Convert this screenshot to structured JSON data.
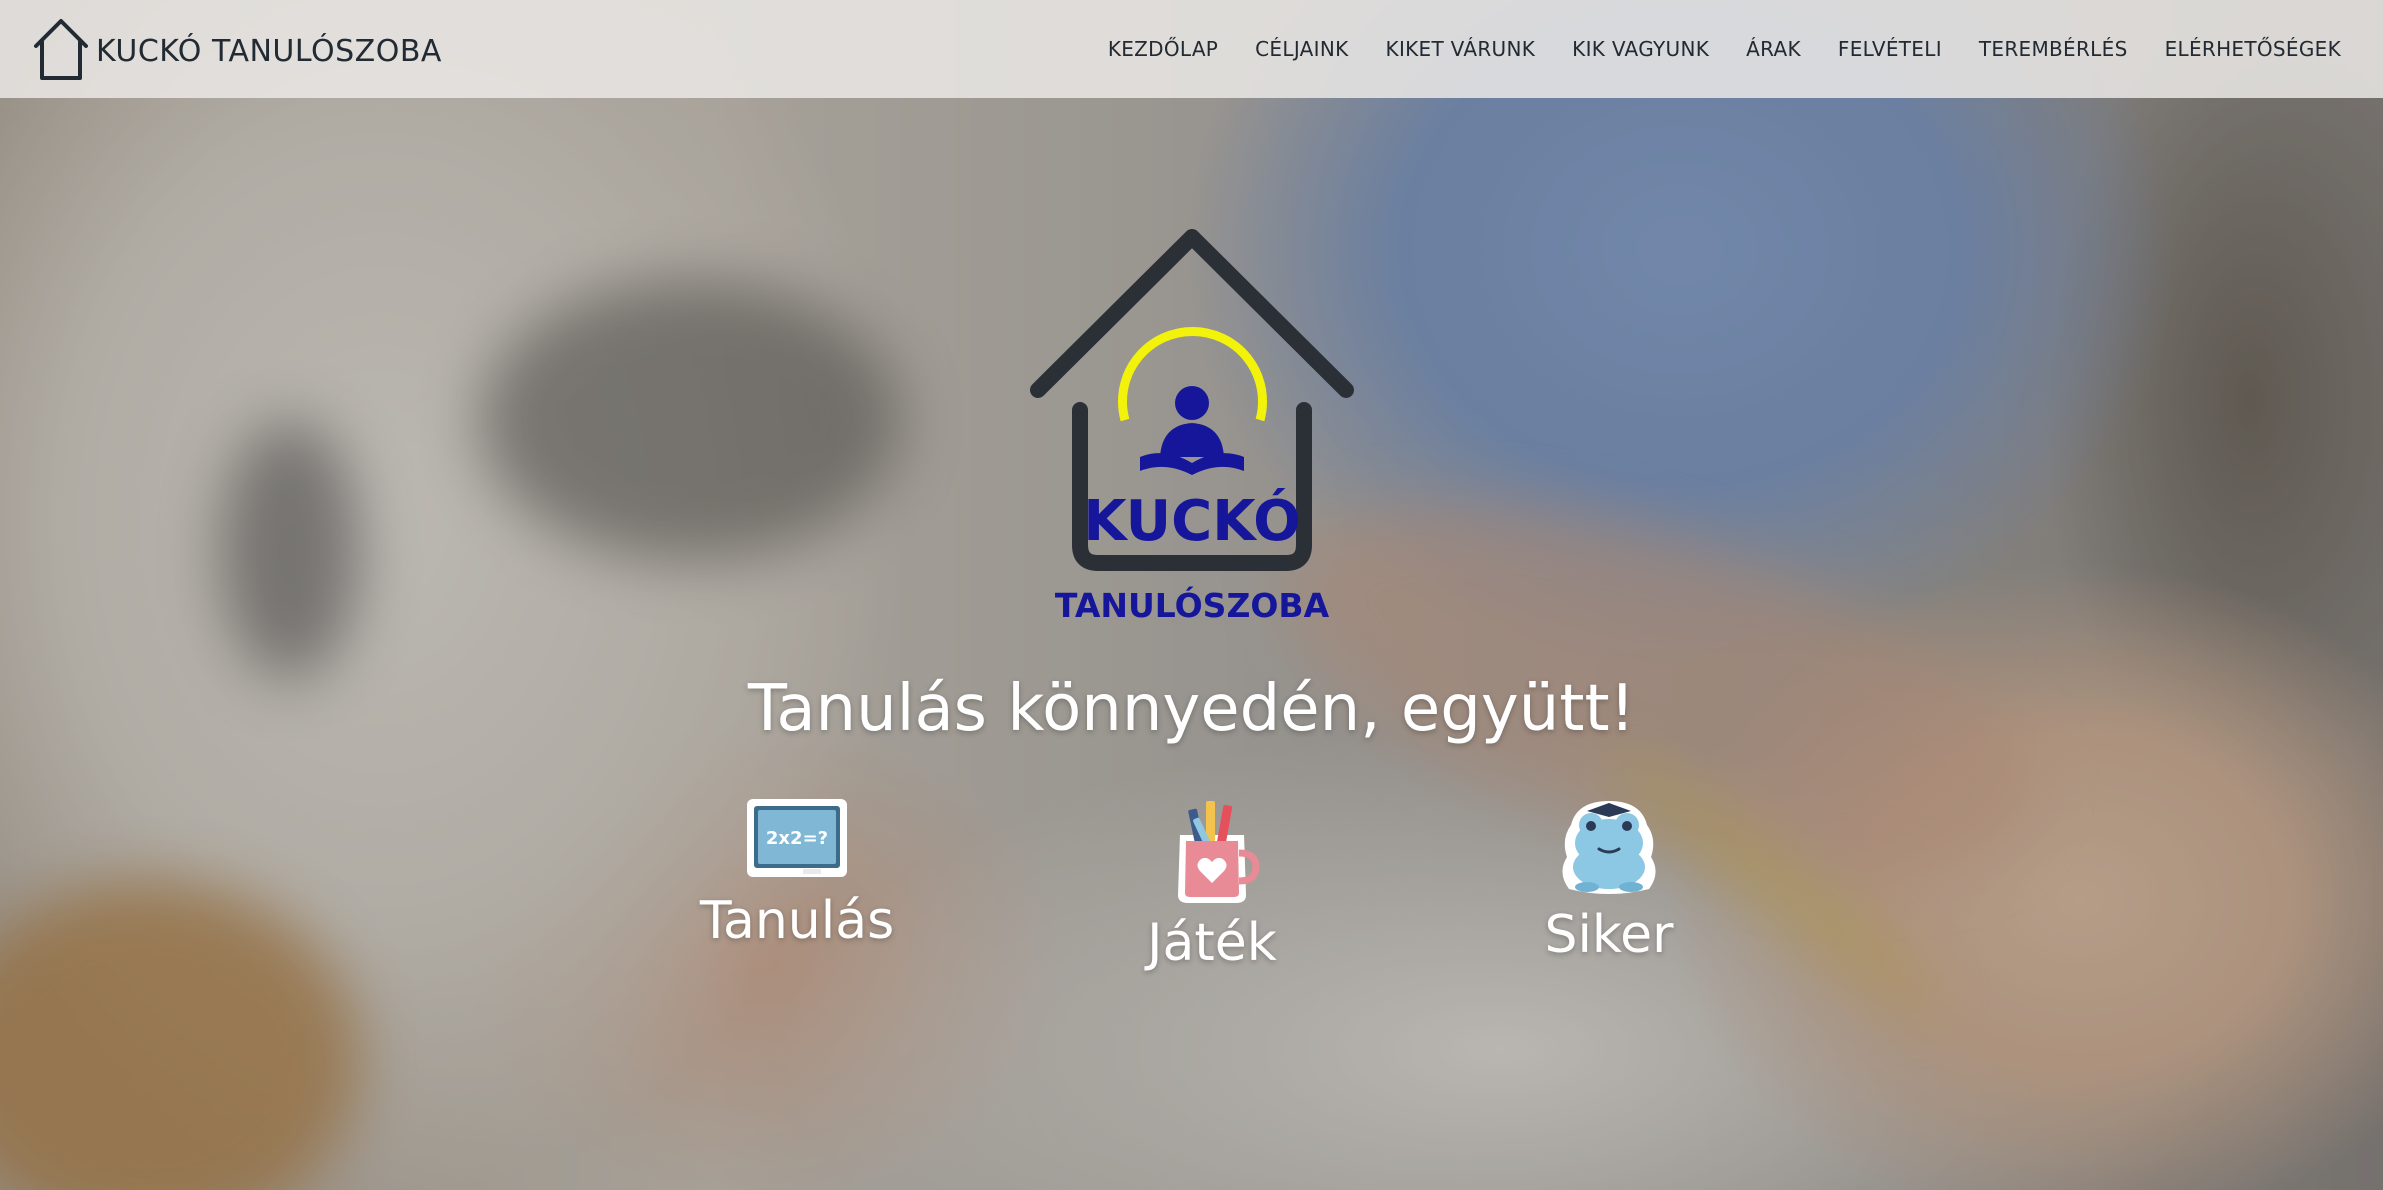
{
  "nav": {
    "brand": "KUCKÓ TANULÓSZOBA",
    "items": [
      {
        "label": "KEZDŐLAP"
      },
      {
        "label": "CÉLJAINK"
      },
      {
        "label": "KIKET VÁRUNK"
      },
      {
        "label": "KIK VAGYUNK"
      },
      {
        "label": "ÁRAK"
      },
      {
        "label": "FELVÉTELI"
      },
      {
        "label": "TEREMBÉRLÉS"
      },
      {
        "label": "ELÉRHETŐSÉGEK"
      }
    ]
  },
  "hero": {
    "logo": {
      "title": "KUCKÓ",
      "subtitle": "TANULÓSZOBA"
    },
    "tagline": "Tanulás könnyedén, együtt!",
    "features": [
      {
        "label": "Tanulás",
        "icon": "chalkboard-icon",
        "board_text": "2x2=?"
      },
      {
        "label": "Játék",
        "icon": "pencil-cup-icon"
      },
      {
        "label": "Siker",
        "icon": "frog-icon"
      }
    ]
  },
  "colors": {
    "nav_bg": "#eae8e5",
    "nav_text": "#222a33",
    "logo_house": "#2b2f36",
    "logo_text": "#16169a",
    "logo_ring": "#f2f20a",
    "hero_text": "#ffffff"
  }
}
